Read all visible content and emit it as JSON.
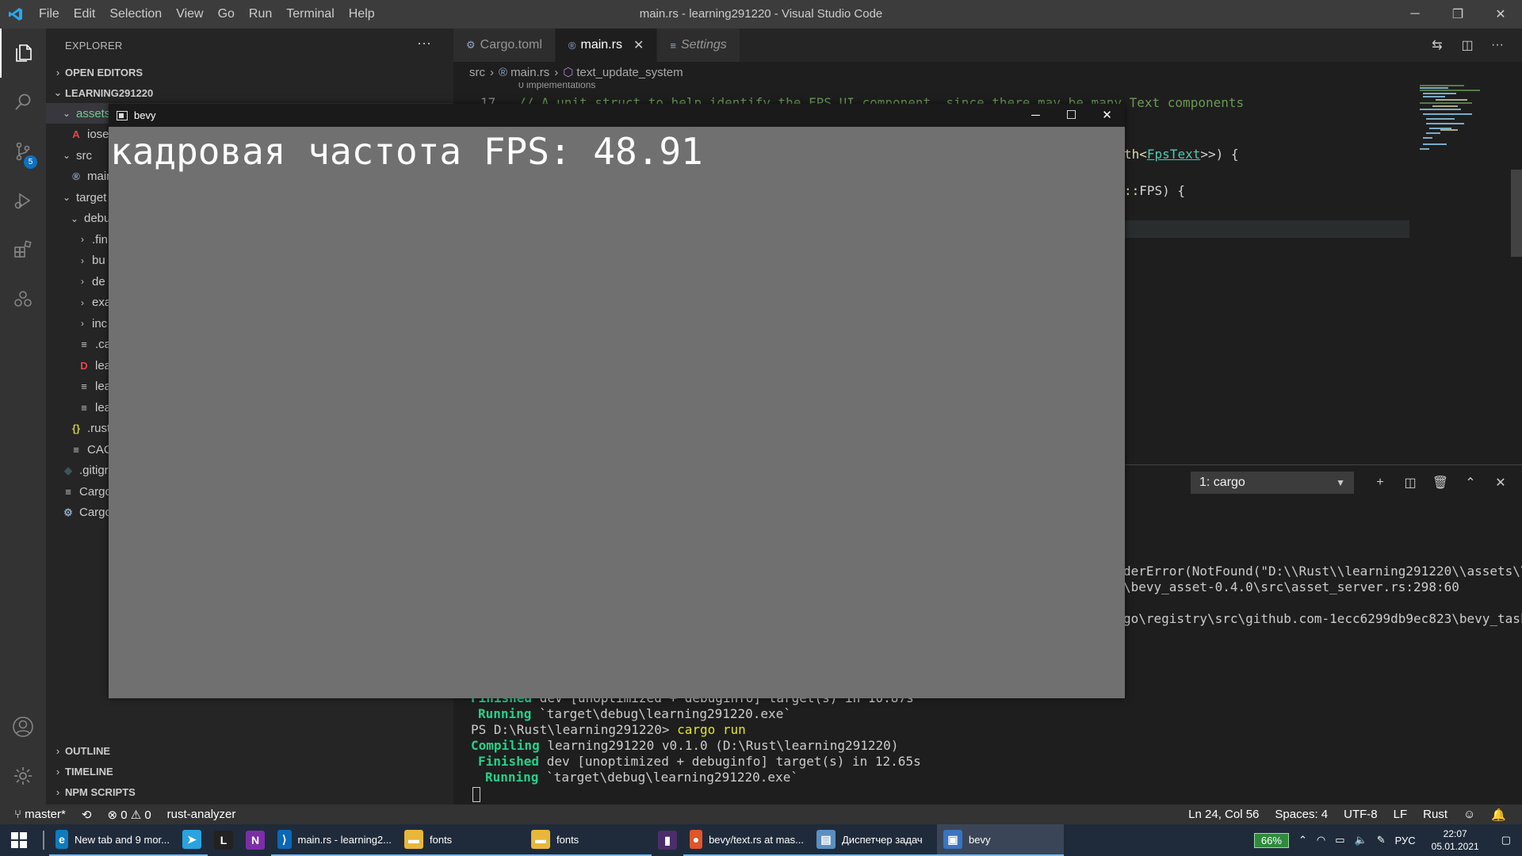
{
  "window": {
    "title": "main.rs - learning291220 - Visual Studio Code",
    "menu": [
      "File",
      "Edit",
      "Selection",
      "View",
      "Go",
      "Run",
      "Terminal",
      "Help"
    ]
  },
  "activitybar": {
    "source_control_badge": "5"
  },
  "sidebar": {
    "title": "EXPLORER",
    "more": "···",
    "sections": {
      "open_editors": "OPEN EDITORS",
      "project": "LEARNING291220",
      "outline": "OUTLINE",
      "timeline": "TIMELINE",
      "npm_scripts": "NPM SCRIPTS"
    },
    "tree": [
      {
        "label": "assets",
        "icon": "chevron-down",
        "indent": 1
      },
      {
        "label": "iose",
        "icon": "font-file",
        "indent": 2
      },
      {
        "label": "src",
        "icon": "chevron-down",
        "indent": 1
      },
      {
        "label": "main",
        "icon": "rust-file",
        "indent": 2
      },
      {
        "label": "target",
        "icon": "chevron-down",
        "indent": 1
      },
      {
        "label": "debu",
        "icon": "chevron-down",
        "indent": 2
      },
      {
        "label": ".fin",
        "icon": "chevron-right",
        "indent": 3
      },
      {
        "label": "bu",
        "icon": "chevron-right",
        "indent": 3
      },
      {
        "label": "de",
        "icon": "chevron-right",
        "indent": 3
      },
      {
        "label": "exa",
        "icon": "chevron-right",
        "indent": 3
      },
      {
        "label": "inc",
        "icon": "chevron-right",
        "indent": 3
      },
      {
        "label": ".ca",
        "icon": "text-file",
        "indent": 3
      },
      {
        "label": "lea",
        "icon": "d-file",
        "indent": 3
      },
      {
        "label": "lea",
        "icon": "text-file",
        "indent": 3
      },
      {
        "label": "lea",
        "icon": "text-file",
        "indent": 3
      },
      {
        "label": ".rust",
        "icon": "json-file",
        "indent": 2
      },
      {
        "label": "CAC",
        "icon": "text-file",
        "indent": 2
      },
      {
        "label": ".gitigr",
        "icon": "git-file",
        "indent": 1
      },
      {
        "label": "Cargo",
        "icon": "text-file",
        "indent": 1
      },
      {
        "label": "Cargo",
        "icon": "gear-file",
        "indent": 1
      }
    ]
  },
  "tabs": [
    {
      "label": "Cargo.toml",
      "icon": "⚙"
    },
    {
      "label": "main.rs",
      "icon": "®",
      "close": "✕"
    },
    {
      "label": "Settings",
      "icon": "≡"
    }
  ],
  "breadcrumb": {
    "src": "src",
    "file": "main.rs",
    "symbol": "text_update_system"
  },
  "editor": {
    "hint": "0 implementations",
    "line_number": "17",
    "comment": "// A unit struct to help identify the FPS UI component, since there may be many Text components",
    "frag1_type": "th<",
    "frag1_name": "FpsText",
    "frag1_end": ">>) {",
    "frag2_a": "::",
    "frag2_b": "FPS) {"
  },
  "panel": {
    "terminal_select": "1: cargo",
    "errors": [
      "derError(NotFound(\"D:\\\\Rust\\\\learning291220\\\\assets\\\\",
      "\\bevy_asset-0.4.0\\src\\asset_server.rs:298:60",
      "go\\registry\\src\\github.com-1ecc6299db9ec823\\bevy_task"
    ],
    "lines": {
      "l1_kw": "Finished",
      "l1_rest": " dev [unoptimized + debuginfo] target(s) in 10.87s",
      "l2_kw": "Running",
      "l2_rest": " `target\\debug\\learning291220.exe`",
      "l3_prompt": "PS D:\\Rust\\learning291220> ",
      "l3_cmd": "cargo run",
      "l4_kw": "Compiling",
      "l4_rest": " learning291220 v0.1.0 (D:\\Rust\\learning291220)",
      "l5_kw": "Finished",
      "l5_rest": " dev [unoptimized + debuginfo] target(s) in 12.65s",
      "l6_kw": "Running",
      "l6_rest": " `target\\debug\\learning291220.exe`"
    }
  },
  "statusbar": {
    "branch": "master*",
    "errors": "0",
    "warnings": "0",
    "extension": "rust-analyzer",
    "position": "Ln 24, Col 56",
    "spaces": "Spaces: 4",
    "encoding": "UTF-8",
    "eol": "LF",
    "language": "Rust"
  },
  "bevy": {
    "title": "bevy",
    "fps_text": "кадровая частота FPS: 48.91"
  },
  "taskbar": {
    "apps": [
      {
        "label": "New tab and 9 mor...",
        "icon": "edge"
      },
      {
        "label": "",
        "icon": "telegram"
      },
      {
        "label": "",
        "icon": "L"
      },
      {
        "label": "",
        "icon": "N"
      },
      {
        "label": "main.rs - learning2...",
        "icon": "vscode"
      },
      {
        "label": "fonts",
        "icon": "folder"
      },
      {
        "label": "fonts",
        "icon": "folder"
      },
      {
        "label": "",
        "icon": "app"
      },
      {
        "label": "bevy/text.rs at mas...",
        "icon": "firefox"
      },
      {
        "label": "Диспетчер задач",
        "icon": "taskmgr"
      },
      {
        "label": "bevy",
        "icon": "bevy"
      }
    ],
    "battery": "66%",
    "lang": "РУС",
    "time": "22:07",
    "date": "05.01.2021"
  }
}
